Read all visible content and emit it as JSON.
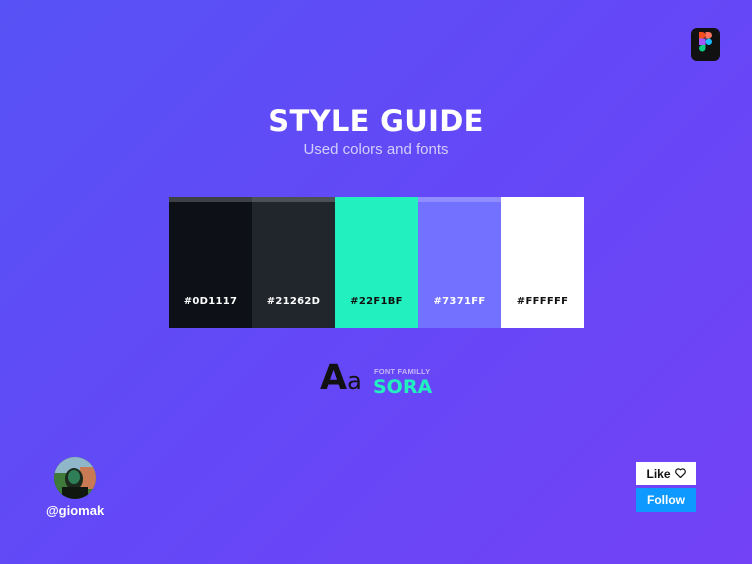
{
  "header": {
    "title": "STYLE GUIDE",
    "subtitle": "Used colors and fonts",
    "app_icon": "figma-logo-icon"
  },
  "palette": [
    {
      "hex": "#0D1117",
      "color": "#0D1117",
      "text_color": "#FFFFFF"
    },
    {
      "hex": "#21262D",
      "color": "#21262D",
      "text_color": "#FFFFFF"
    },
    {
      "hex": "#22F1BF",
      "color": "#22F1BF",
      "text_color": "#111111"
    },
    {
      "hex": "#7371FF",
      "color": "#7371FF",
      "text_color": "#FFFFFF"
    },
    {
      "hex": "#FFFFFF",
      "color": "#FFFFFF",
      "text_color": "#111111"
    }
  ],
  "font": {
    "sample_big": "A",
    "sample_small": "a",
    "label": "FONT FAMILLY",
    "name": "SORA"
  },
  "author": {
    "username": "@giomak"
  },
  "actions": {
    "like_label": "Like",
    "like_icon": "heart-icon",
    "follow_label": "Follow"
  }
}
